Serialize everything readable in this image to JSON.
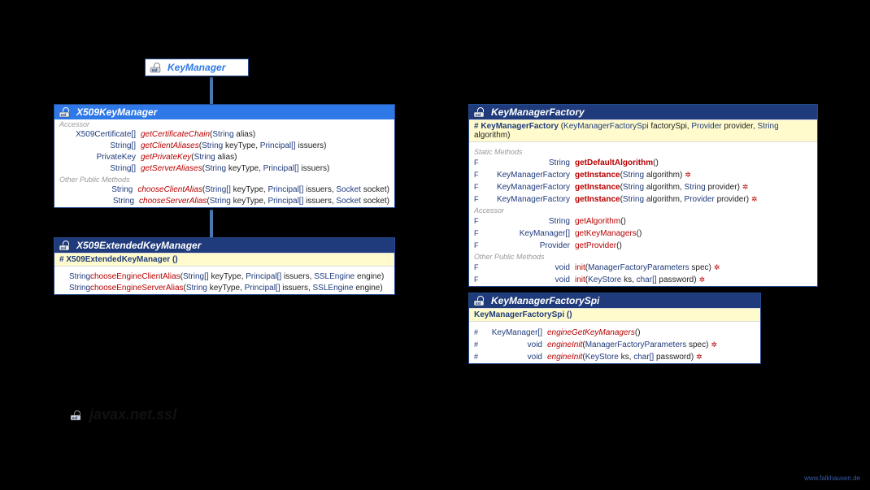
{
  "package": "javax.net.ssl",
  "credit": "www.falkhausen.de",
  "icons": {
    "ssl": "ssl"
  },
  "keyManager": {
    "title": "KeyManager"
  },
  "x509KeyManager": {
    "title": "X509KeyManager",
    "sections": {
      "accessor": "Accessor",
      "other": "Other Public Methods"
    },
    "rows": [
      {
        "ret": "X509Certificate[]",
        "name": "getCertificateChain",
        "params": [
          [
            "String",
            "alias"
          ]
        ],
        "it": true
      },
      {
        "ret": "String[]",
        "name": "getClientAliases",
        "params": [
          [
            "String",
            "keyType"
          ],
          [
            "Principal[]",
            "issuers"
          ]
        ],
        "it": true
      },
      {
        "ret": "PrivateKey",
        "name": "getPrivateKey",
        "params": [
          [
            "String",
            "alias"
          ]
        ],
        "it": true
      },
      {
        "ret": "String[]",
        "name": "getServerAliases",
        "params": [
          [
            "String",
            "keyType"
          ],
          [
            "Principal[]",
            "issuers"
          ]
        ],
        "it": true
      },
      {
        "ret": "String",
        "name": "chooseClientAlias",
        "params": [
          [
            "String[]",
            "keyType"
          ],
          [
            "Principal[]",
            "issuers"
          ],
          [
            "Socket",
            "socket"
          ]
        ],
        "it": true
      },
      {
        "ret": "String",
        "name": "chooseServerAlias",
        "params": [
          [
            "String",
            "keyType"
          ],
          [
            "Principal[]",
            "issuers"
          ],
          [
            "Socket",
            "socket"
          ]
        ],
        "it": true
      }
    ]
  },
  "x509Ext": {
    "title": "X509ExtendedKeyManager",
    "ctor": "X509ExtendedKeyManager ()",
    "rows": [
      {
        "ret": "String",
        "name": "chooseEngineClientAlias",
        "params": [
          [
            "String[]",
            "keyType"
          ],
          [
            "Principal[]",
            "issuers"
          ],
          [
            "SSLEngine",
            "engine"
          ]
        ]
      },
      {
        "ret": "String",
        "name": "chooseEngineServerAlias",
        "params": [
          [
            "String",
            "keyType"
          ],
          [
            "Principal[]",
            "issuers"
          ],
          [
            "SSLEngine",
            "engine"
          ]
        ]
      }
    ]
  },
  "kmFactory": {
    "title": "KeyManagerFactory",
    "ctor": {
      "mod": "#",
      "name": "KeyManagerFactory",
      "params": [
        [
          "KeyManagerFactorySpi",
          "factorySpi"
        ],
        [
          "Provider",
          "provider"
        ],
        [
          "String",
          "algorithm"
        ]
      ]
    },
    "sections": {
      "static": "Static Methods",
      "accessor": "Accessor",
      "other": "Other Public Methods"
    },
    "static": [
      {
        "mod": "F",
        "ret": "String",
        "name": "getDefaultAlgorithm",
        "params": [],
        "bd": true
      },
      {
        "mod": "F",
        "ret": "KeyManagerFactory",
        "name": "getInstance",
        "params": [
          [
            "String",
            "algorithm"
          ]
        ],
        "bd": true,
        "ex": true
      },
      {
        "mod": "F",
        "ret": "KeyManagerFactory",
        "name": "getInstance",
        "params": [
          [
            "String",
            "algorithm"
          ],
          [
            "String",
            "provider"
          ]
        ],
        "bd": true,
        "ex": true
      },
      {
        "mod": "F",
        "ret": "KeyManagerFactory",
        "name": "getInstance",
        "params": [
          [
            "String",
            "algorithm"
          ],
          [
            "Provider",
            "provider"
          ]
        ],
        "bd": true,
        "ex": true
      }
    ],
    "accessor": [
      {
        "mod": "F",
        "ret": "String",
        "name": "getAlgorithm",
        "params": []
      },
      {
        "mod": "F",
        "ret": "KeyManager[]",
        "name": "getKeyManagers",
        "params": []
      },
      {
        "mod": "F",
        "ret": "Provider",
        "name": "getProvider",
        "params": []
      }
    ],
    "other": [
      {
        "mod": "F",
        "ret": "void",
        "name": "init",
        "params": [
          [
            "ManagerFactoryParameters",
            "spec"
          ]
        ],
        "ex": true
      },
      {
        "mod": "F",
        "ret": "void",
        "name": "init",
        "params": [
          [
            "KeyStore",
            "ks"
          ],
          [
            "char[]",
            "password"
          ]
        ],
        "ex": true
      }
    ]
  },
  "kmFactorySpi": {
    "title": "KeyManagerFactorySpi",
    "ctor": "KeyManagerFactorySpi ()",
    "rows": [
      {
        "mod": "#",
        "ret": "KeyManager[]",
        "name": "engineGetKeyManagers",
        "params": [],
        "it": true
      },
      {
        "mod": "#",
        "ret": "void",
        "name": "engineInit",
        "params": [
          [
            "ManagerFactoryParameters",
            "spec"
          ]
        ],
        "it": true,
        "ex": true
      },
      {
        "mod": "#",
        "ret": "void",
        "name": "engineInit",
        "params": [
          [
            "KeyStore",
            "ks"
          ],
          [
            "char[]",
            "password"
          ]
        ],
        "it": true,
        "ex": true
      }
    ]
  }
}
